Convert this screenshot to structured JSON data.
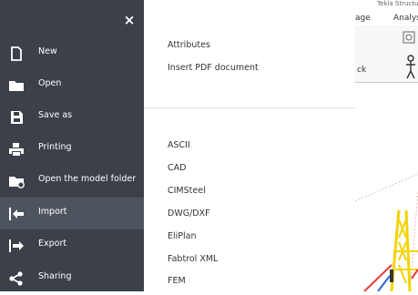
{
  "sidebar": {
    "close_label": "×",
    "items": [
      {
        "label": "New",
        "icon": "new-document-icon"
      },
      {
        "label": "Open",
        "icon": "folder-icon"
      },
      {
        "label": "Save as",
        "icon": "save-icon"
      },
      {
        "label": "Printing",
        "icon": "printer-icon"
      },
      {
        "label": "Open the model folder",
        "icon": "folder-settings-icon"
      },
      {
        "label": "Import",
        "icon": "import-arrow-icon",
        "active": true
      },
      {
        "label": "Export",
        "icon": "export-arrow-icon"
      },
      {
        "label": "Sharing",
        "icon": "share-icon"
      }
    ]
  },
  "submenu": {
    "top_items": [
      "Attributes",
      "Insert PDF document"
    ],
    "bottom_items": [
      "ASCII",
      "CAD",
      "CIMSteel",
      "DWG/DXF",
      "EliPlan",
      "Fabtrol XML",
      "FEM"
    ]
  },
  "background_app": {
    "tab_partial_1": "age",
    "tab_partial_2": "Analys",
    "ribbon_partial": "ck",
    "header_partial": "Tekla Structures"
  },
  "colors": {
    "sidebar_bg": "#3b4049",
    "sidebar_active": "#4e545e",
    "highlight": "#f3f200",
    "model_yellow": "#f2d400"
  }
}
